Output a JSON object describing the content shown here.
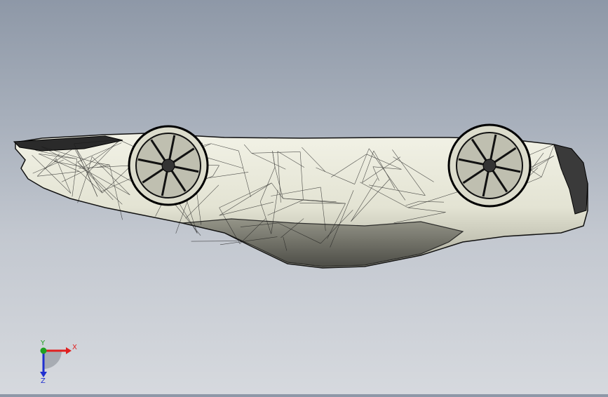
{
  "viewport": {
    "model": "car-wireframe-upside-down",
    "colors": {
      "background_top": "#8e98a7",
      "background_bottom": "#d6d9de",
      "body_fill": "#e6e6d8",
      "body_shadow": "#b9b9a8",
      "mesh_line": "#1a1a1a"
    }
  },
  "triad": {
    "x_label": "X",
    "y_label": "Y",
    "z_label": "Z",
    "colors": {
      "x": "#e02020",
      "y": "#20a020",
      "z": "#2030d0"
    }
  }
}
